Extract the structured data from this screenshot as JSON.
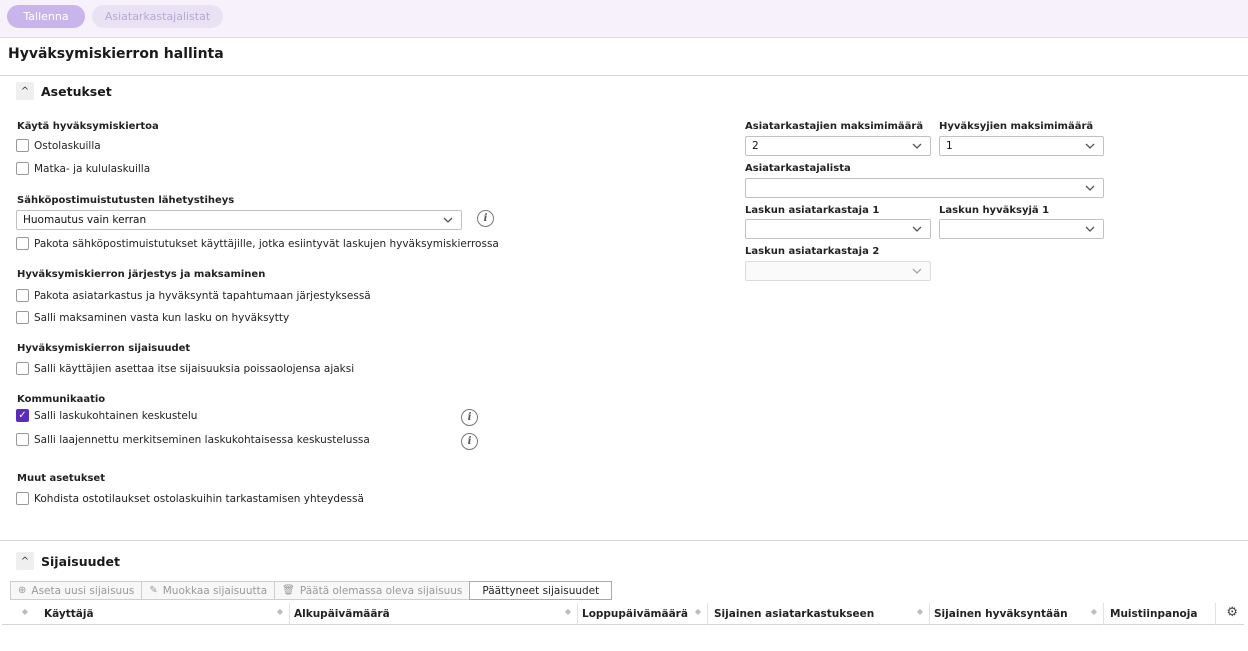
{
  "toolbar": {
    "save_label": "Tallenna",
    "reviewer_lists_label": "Asiatarkastajalistat"
  },
  "page": {
    "title": "Hyväksymiskierron hallinta"
  },
  "settings": {
    "heading": "Asetukset",
    "use_group": {
      "label": "Käytä hyväksymiskiertoa",
      "opt1": "Ostolaskuilla",
      "opt2": "Matka- ja kululaskuilla"
    },
    "email_group": {
      "label": "Sähköpostimuistutusten lähetystiheys",
      "select_value": "Huomautus vain kerran",
      "force_label": "Pakota sähköpostimuistutukset käyttäjille, jotka esiintyvät laskujen hyväksymiskierrossa"
    },
    "order_group": {
      "label": "Hyväksymiskierron järjestys ja maksaminen",
      "opt1": "Pakota asiatarkastus ja hyväksyntä tapahtumaan järjestyksessä",
      "opt2": "Salli maksaminen vasta kun lasku on hyväksytty"
    },
    "subst_group": {
      "label": "Hyväksymiskierron sijaisuudet",
      "opt1": "Salli käyttäjien asettaa itse sijaisuuksia poissaolojensa ajaksi"
    },
    "comm_group": {
      "label": "Kommunikaatio",
      "opt1": "Salli laskukohtainen keskustelu",
      "opt2": "Salli laajennettu merkitseminen laskukohtaisessa keskustelussa"
    },
    "other_group": {
      "label": "Muut asetukset",
      "opt1": "Kohdista ostotilaukset ostolaskuihin tarkastamisen yhteydessä"
    },
    "right": {
      "max_reviewers_label": "Asiatarkastajien maksimimäärä",
      "max_reviewers_value": "2",
      "max_approvers_label": "Hyväksyjien maksimimäärä",
      "max_approvers_value": "1",
      "reviewer_list_label": "Asiatarkastajalista",
      "reviewer_list_value": "",
      "reviewer1_label": "Laskun asiatarkastaja 1",
      "reviewer1_value": "",
      "approver1_label": "Laskun hyväksyjä 1",
      "approver1_value": "",
      "reviewer2_label": "Laskun asiatarkastaja 2",
      "reviewer2_value": ""
    }
  },
  "substitutions": {
    "heading": "Sijaisuudet",
    "buttons": {
      "add": "Aseta uusi sijaisuus",
      "edit": "Muokkaa sijaisuutta",
      "end": "Päätä olemassa oleva sijaisuus",
      "ended": "Päättyneet sijaisuudet"
    },
    "columns": [
      "Käyttäjä",
      "Alkupäivämäärä",
      "Loppupäivämäärä",
      "Sijainen asiatarkastukseen",
      "Sijainen hyväksyntään",
      "Muistiinpanoja"
    ]
  }
}
